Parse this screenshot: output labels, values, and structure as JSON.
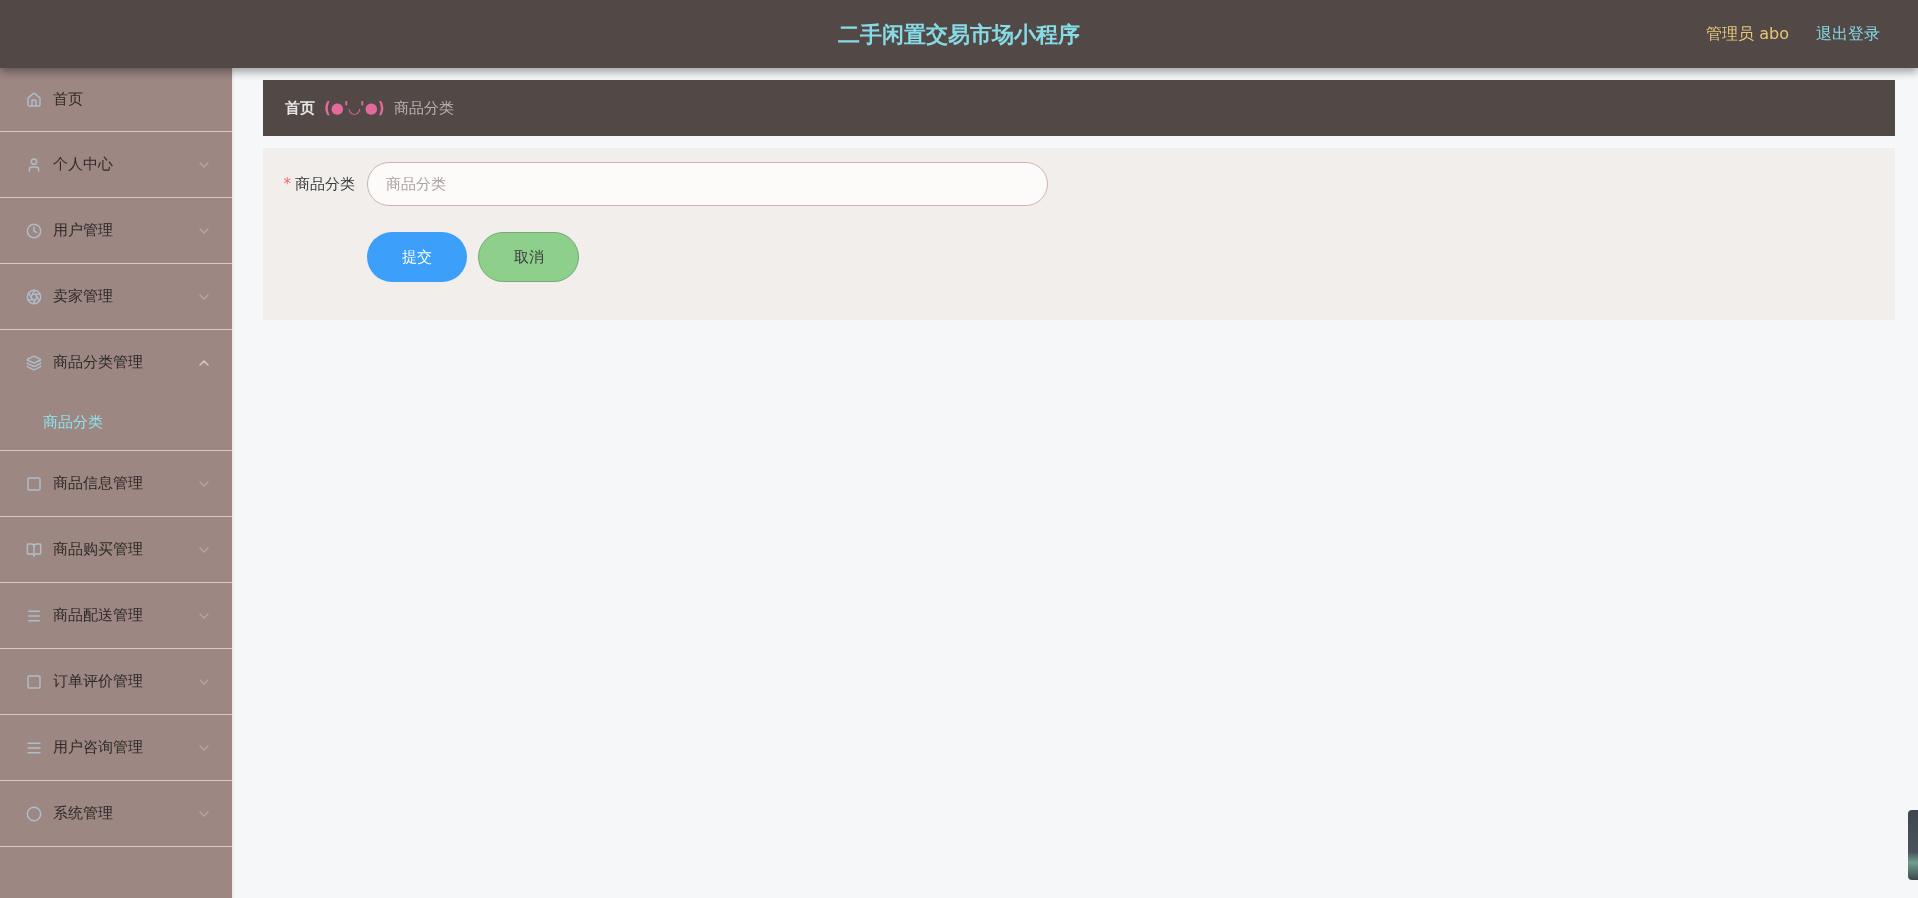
{
  "header": {
    "title": "二手闲置交易市场小程序",
    "user": "管理员 abo",
    "logout": "退出登录"
  },
  "sidebar": {
    "items": [
      {
        "label": "首页",
        "kind": "link",
        "selected": false
      },
      {
        "label": "个人中心",
        "kind": "menu",
        "expanded": false,
        "selected": false
      },
      {
        "label": "用户管理",
        "kind": "menu",
        "expanded": false,
        "selected": false
      },
      {
        "label": "卖家管理",
        "kind": "menu",
        "expanded": false,
        "selected": false
      },
      {
        "label": "商品分类管理",
        "kind": "menu",
        "expanded": true,
        "selected": false,
        "children": [
          {
            "label": "商品分类",
            "selected": true
          }
        ]
      },
      {
        "label": "商品信息管理",
        "kind": "menu",
        "expanded": false,
        "selected": false
      },
      {
        "label": "商品购买管理",
        "kind": "menu",
        "expanded": false,
        "selected": false
      },
      {
        "label": "商品配送管理",
        "kind": "menu",
        "expanded": false,
        "selected": false
      },
      {
        "label": "订单评价管理",
        "kind": "menu",
        "expanded": false,
        "selected": false
      },
      {
        "label": "用户咨询管理",
        "kind": "menu",
        "expanded": false,
        "selected": false
      },
      {
        "label": "系统管理",
        "kind": "menu",
        "expanded": false,
        "selected": false
      }
    ]
  },
  "breadcrumb": [
    {
      "label": "首页",
      "kind": "home"
    },
    {
      "label": "(●'◡'●)",
      "kind": "separator"
    },
    {
      "label": "商品分类",
      "kind": "current"
    }
  ],
  "form": {
    "fields": [
      {
        "label": "商品分类",
        "required_mark": "*",
        "placeholder": "商品分类"
      }
    ],
    "buttons": [
      {
        "label": "提交",
        "kind": "primary"
      },
      {
        "label": "取消",
        "kind": "cancel"
      }
    ]
  }
}
